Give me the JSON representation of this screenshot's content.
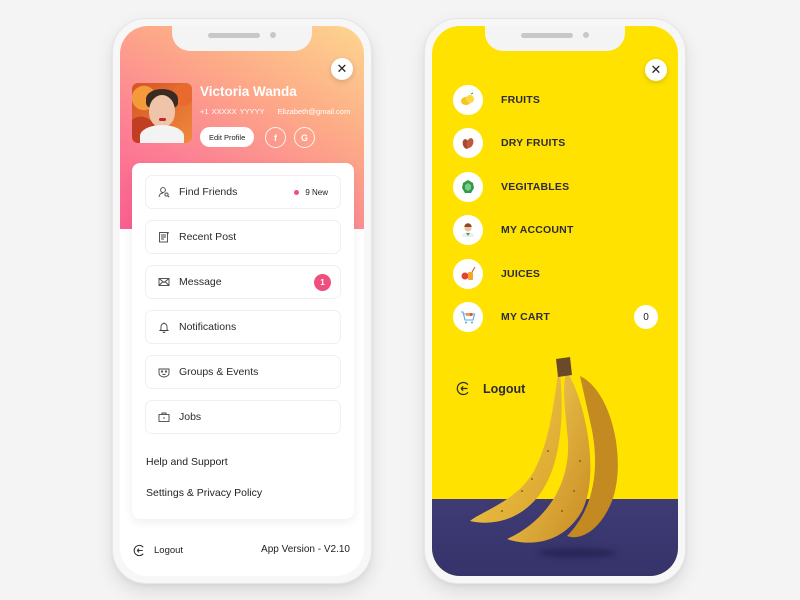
{
  "left_phone": {
    "profile": {
      "name": "Victoria Wanda",
      "phone": "+1 XXXXX YYYYY",
      "email": "Elizabeth@gmail.com",
      "edit_button": "Edit Profile",
      "social": [
        {
          "icon": "facebook-icon",
          "glyph": "f"
        },
        {
          "icon": "google-icon",
          "glyph": "G"
        }
      ],
      "close_glyph": "✕"
    },
    "menu": [
      {
        "label": "Find Friends",
        "icon": "find-friends-icon",
        "badge_text": "9 New"
      },
      {
        "label": "Recent Post",
        "icon": "recent-post-icon"
      },
      {
        "label": "Message",
        "icon": "envelope-icon",
        "count": "1"
      },
      {
        "label": "Notifications",
        "icon": "bell-icon"
      },
      {
        "label": "Groups & Events",
        "icon": "groups-events-icon"
      },
      {
        "label": "Jobs",
        "icon": "briefcase-icon"
      }
    ],
    "links": [
      "Help and Support",
      "Settings & Privacy Policy"
    ],
    "footer": {
      "logout": "Logout",
      "version": "App Version - V2.10"
    },
    "colors": {
      "gradient_start": "#fb5e8f",
      "gradient_end": "#fdd68f",
      "accent_pink": "#ef4f7e"
    }
  },
  "right_phone": {
    "close_glyph": "✕",
    "categories": [
      {
        "label": "FRUITS",
        "icon": "lemon-icon"
      },
      {
        "label": "DRY FRUITS",
        "icon": "almond-icon"
      },
      {
        "label": "VEGITABLES",
        "icon": "cabbage-icon"
      },
      {
        "label": "MY ACCOUNT",
        "icon": "user-avatar-icon"
      },
      {
        "label": "JUICES",
        "icon": "juice-icon"
      },
      {
        "label": "MY CART",
        "icon": "cart-icon",
        "count": "0"
      }
    ],
    "logout": "Logout",
    "colors": {
      "background": "#ffe200",
      "surface": "#3f3b75",
      "text": "#2c2b3c"
    }
  }
}
